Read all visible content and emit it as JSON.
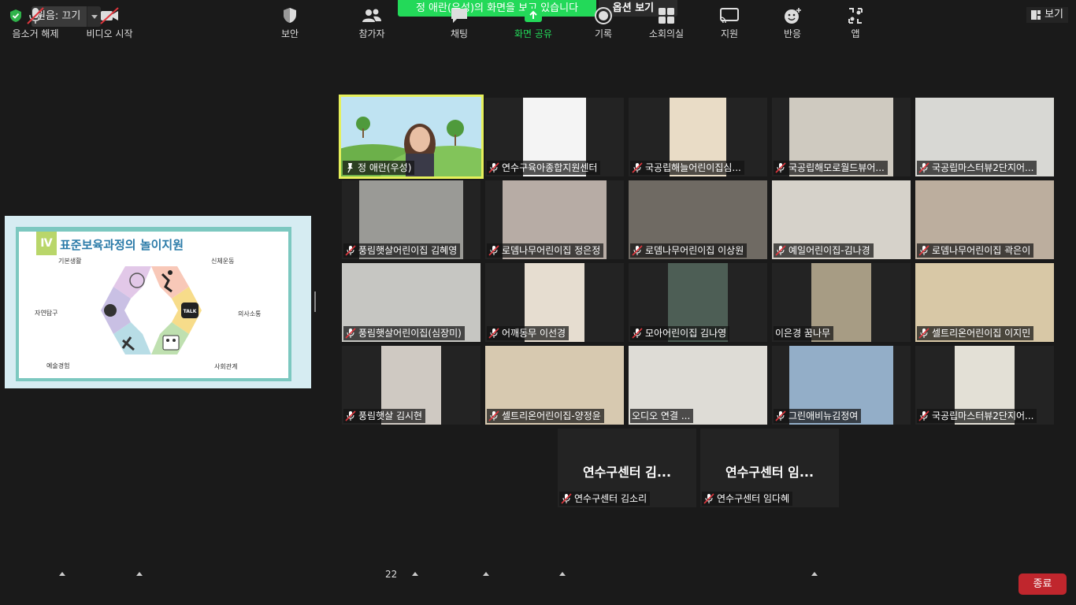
{
  "top": {
    "original_sound": "원음: 끄기",
    "share_banner": "정 애란(우성)의 화면을 보고 있습니다",
    "view_options": "옵션 보기",
    "view": "보기"
  },
  "slide": {
    "badge": "Ⅳ",
    "title": "표준보육과정의 놀이지원",
    "labels": {
      "basic": "기본생활",
      "body": "신체운동",
      "nature": "자연탐구",
      "comm": "의사소통",
      "art": "예술경험",
      "social": "사회관계"
    },
    "talk": "TALK"
  },
  "participants": [
    "정 애란(우성)",
    "연수구육아종합지원센터",
    "국공립해늘어린이집심...",
    "국공립해모로월드뷰어...",
    "국공립마스터뷰2단지어...",
    "풍림햇살어린이집 김혜영",
    "로뎀나무어린이집 정은정",
    "로뎀나무어린이집 이상원",
    "예일어린이집-김나경",
    "로뎀나무어린이집 곽은이",
    "풍림햇살어린이집(심장미)",
    "어깨동무 이선경",
    "모아어린이집 김나영",
    "이은경 꿈나무",
    "셀트리온어린이집 이지민",
    "풍림햇살 김시현",
    "셀트리온어린이집-양정윤",
    "오디오 연결 ...",
    "그린애비뉴김정여",
    "국공립마스터뷰2단지어...",
    "연수구센터 김소리",
    "연수구센터 임다혜"
  ],
  "no_video_tiles": {
    "t20": "연수구센터 김...",
    "t21": "연수구센터 임..."
  },
  "toolbar": {
    "unmute": "음소거 해제",
    "start_video": "비디오 시작",
    "security": "보안",
    "participants": "참가자",
    "participants_count": "22",
    "chat": "채팅",
    "share": "화면 공유",
    "record": "기록",
    "breakout": "소회의실",
    "support": "지원",
    "reactions": "반응",
    "apps": "앱",
    "end": "종료"
  },
  "colors": {
    "active_border": "#e6f05a",
    "share_green": "#23d959",
    "end_red": "#c0262d",
    "mic_off_red": "#e0363d"
  }
}
